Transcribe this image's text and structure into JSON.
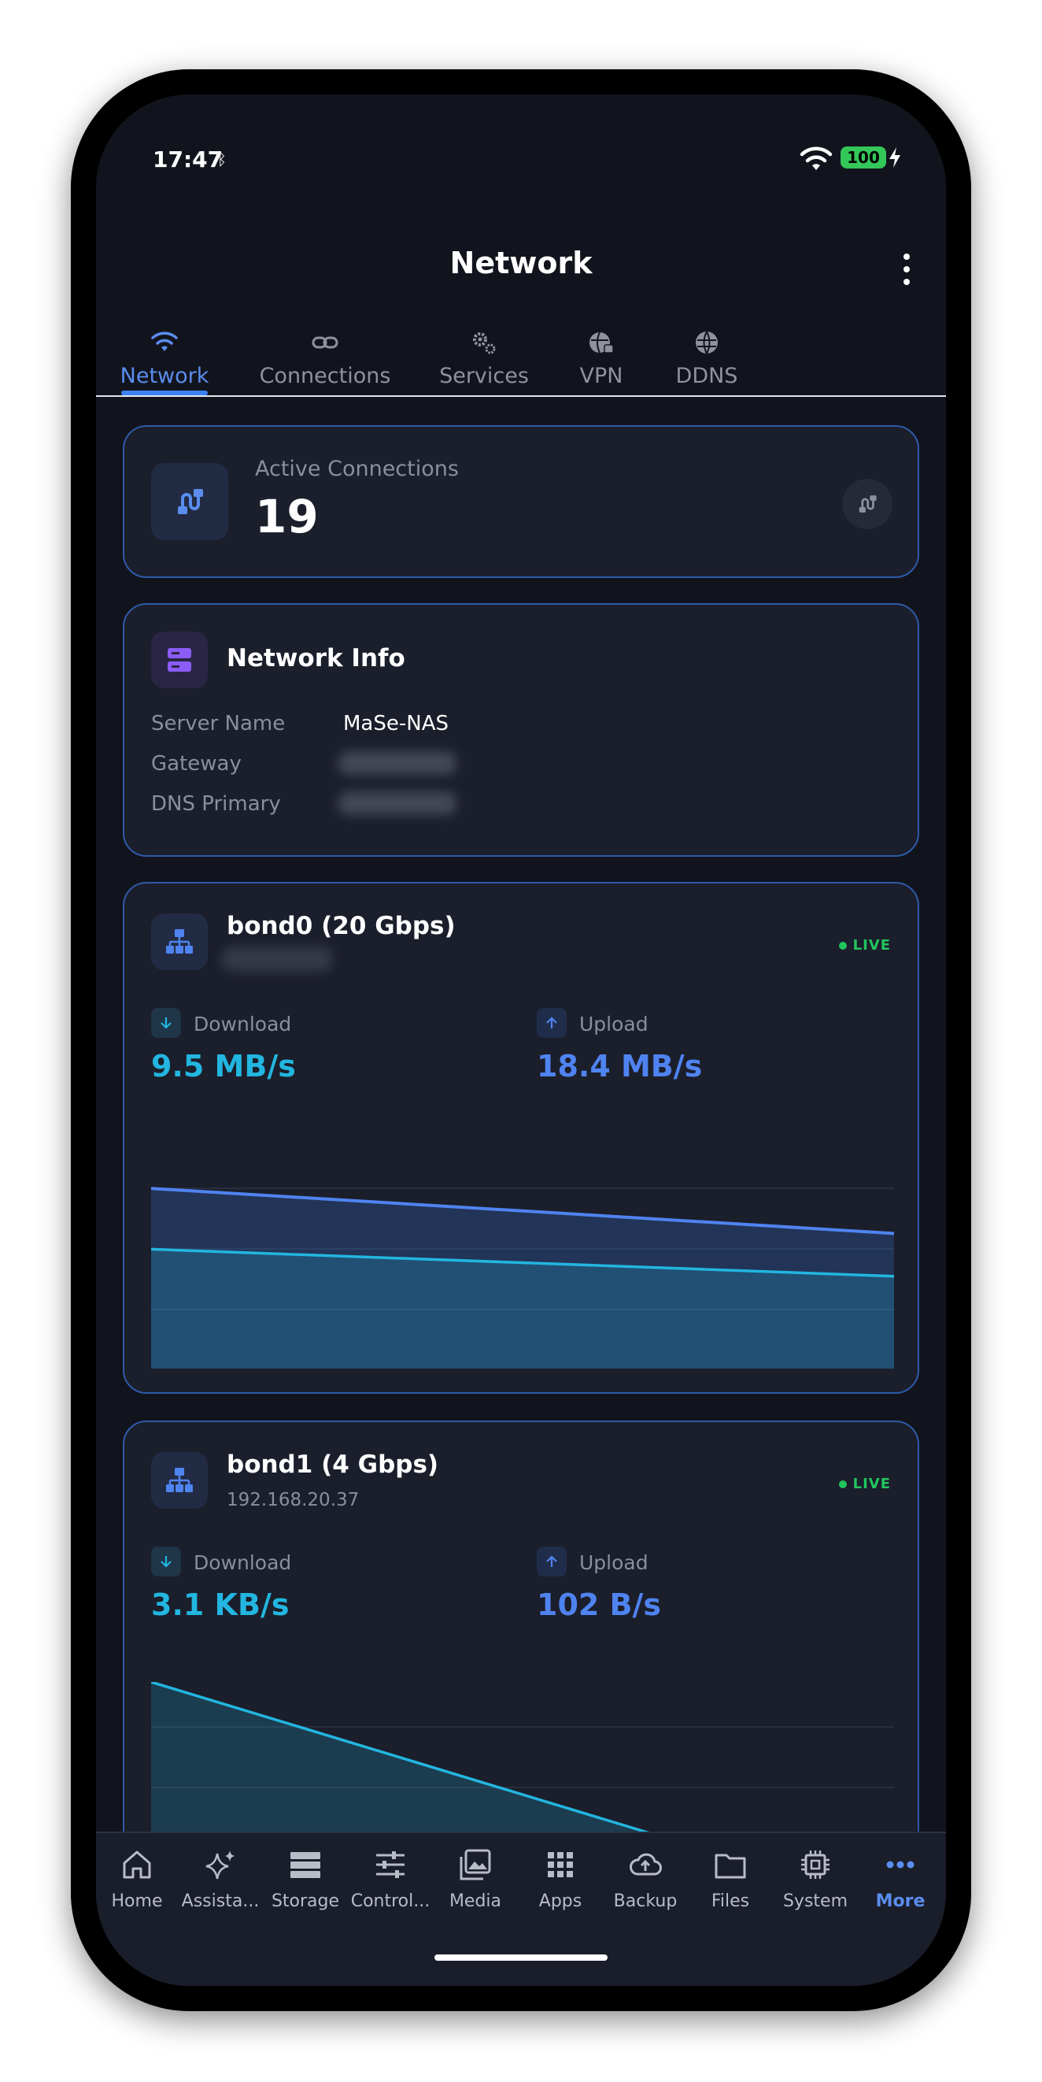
{
  "status_bar": {
    "time": "17:47",
    "extra": "ᛒ",
    "battery": "100"
  },
  "header": {
    "title": "Network"
  },
  "tabs": [
    {
      "label": "Network",
      "icon": "wifi-icon",
      "active": true
    },
    {
      "label": "Connections",
      "icon": "link-icon",
      "active": false
    },
    {
      "label": "Services",
      "icon": "gears-icon",
      "active": false
    },
    {
      "label": "VPN",
      "icon": "globe-lock-icon",
      "active": false
    },
    {
      "label": "DDNS",
      "icon": "globe-icon",
      "active": false
    }
  ],
  "active_connections": {
    "label": "Active Connections",
    "value": "19"
  },
  "network_info": {
    "title": "Network Info",
    "rows": [
      {
        "label": "Server Name",
        "value": "MaSe-NAS"
      },
      {
        "label": "Gateway",
        "value": ""
      },
      {
        "label": "DNS Primary",
        "value": ""
      }
    ]
  },
  "interfaces": [
    {
      "name": "bond0 (20 Gbps)",
      "address": "",
      "status": "LIVE",
      "download_label": "Download",
      "download_rate": "9.5 MB/s",
      "upload_label": "Upload",
      "upload_rate": "18.4 MB/s",
      "chart": {
        "upload": [
          0.8,
          0.6
        ],
        "download": [
          0.53,
          0.41
        ]
      }
    },
    {
      "name": "bond1 (4 Gbps)",
      "address": "192.168.20.37",
      "status": "LIVE",
      "download_label": "Download",
      "download_rate": "3.1 KB/s",
      "upload_label": "Upload",
      "upload_rate": "102 B/s",
      "chart": {
        "download": [
          1.0,
          0.0
        ]
      }
    }
  ],
  "bottom_nav": [
    {
      "label": "Home",
      "icon": "home-icon",
      "active": false
    },
    {
      "label": "Assista...",
      "icon": "sparkle-icon",
      "active": false
    },
    {
      "label": "Storage",
      "icon": "storage-icon",
      "active": false
    },
    {
      "label": "Control...",
      "icon": "sliders-icon",
      "active": false
    },
    {
      "label": "Media",
      "icon": "photos-icon",
      "active": false
    },
    {
      "label": "Apps",
      "icon": "grid-icon",
      "active": false
    },
    {
      "label": "Backup",
      "icon": "cloud-upload-icon",
      "active": false
    },
    {
      "label": "Files",
      "icon": "folder-icon",
      "active": false
    },
    {
      "label": "System",
      "icon": "chip-icon",
      "active": false
    },
    {
      "label": "More",
      "icon": "more-icon",
      "active": true
    }
  ],
  "colors": {
    "background": "#12141d",
    "card": "#1b1e2b",
    "card_border": "#2e5aa8",
    "accent": "#3b82f6",
    "download": "#22b6e0",
    "upload": "#4f83f0",
    "live": "#22c55e"
  }
}
